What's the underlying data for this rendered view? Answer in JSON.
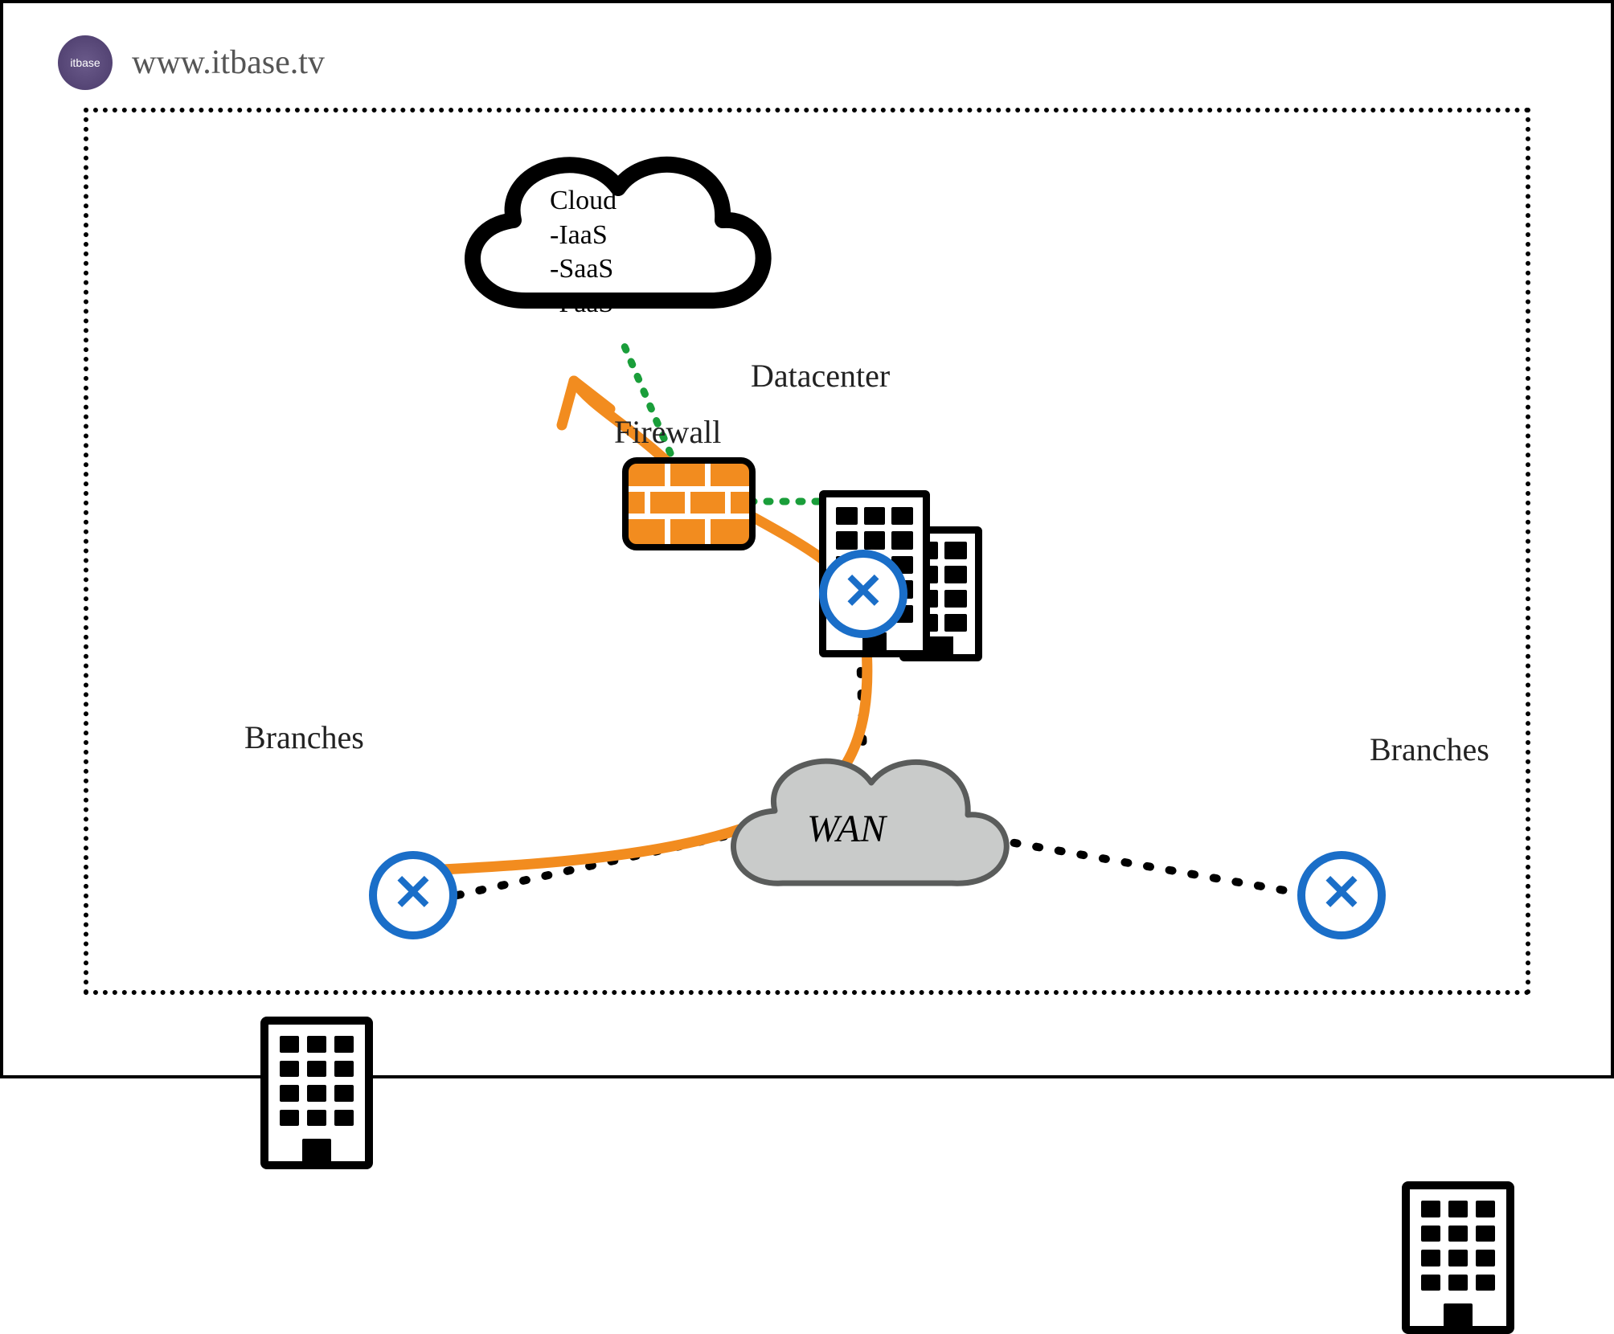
{
  "header": {
    "logo_text": "itbase",
    "url": "www.itbase.tv"
  },
  "nodes": {
    "cloud": {
      "title": "Cloud",
      "items": [
        "-IaaS",
        "-SaaS",
        "-PaaS"
      ]
    },
    "firewall_label": "Firewall",
    "datacenter_label": "Datacenter",
    "wan_label": "WAN",
    "branch_left_label": "Branches",
    "branch_right_label": "Branches"
  },
  "diagram": {
    "routers": [
      "datacenter-router",
      "branch-left-router",
      "branch-right-router"
    ],
    "links": [
      {
        "from": "branch-left-router",
        "to": "wan",
        "style": "black-dotted"
      },
      {
        "from": "branch-right-router",
        "to": "wan",
        "style": "black-dotted"
      },
      {
        "from": "datacenter-router",
        "to": "wan",
        "style": "black-dotted"
      },
      {
        "from": "firewall",
        "to": "datacenter",
        "style": "green-dotted"
      },
      {
        "from": "firewall",
        "to": "cloud",
        "style": "green-dotted"
      },
      {
        "from": "branch-left-router",
        "to": "cloud",
        "via": [
          "wan",
          "datacenter-router",
          "firewall"
        ],
        "style": "orange-path",
        "arrow": "end"
      }
    ]
  }
}
